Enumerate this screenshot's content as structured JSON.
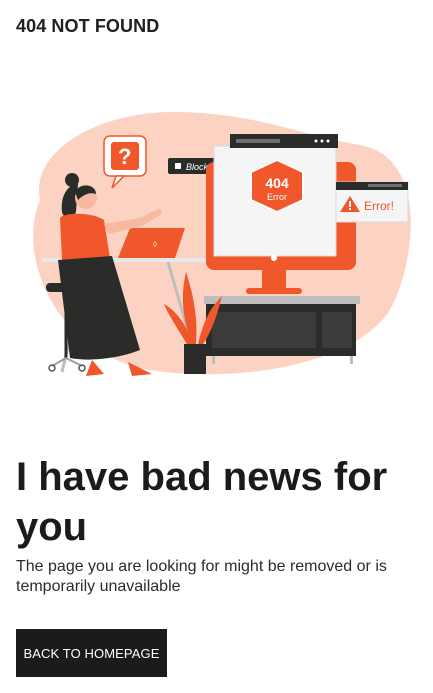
{
  "brand": {
    "title": "404 NOT FOUND"
  },
  "illustration": {
    "question_mark": "?",
    "blocked_label": "Blocked",
    "badge_code": "404",
    "badge_text": "Error",
    "error_label": "Error!",
    "colors": {
      "accent": "#f0582c",
      "blob": "#fcd2c3",
      "dark": "#2a2c2a"
    }
  },
  "content": {
    "headline": "I have bad news for you",
    "message": "The page you are looking for might be removed or is temporarily unavailable"
  },
  "actions": {
    "back_label": "BACK TO HOMEPAGE"
  }
}
